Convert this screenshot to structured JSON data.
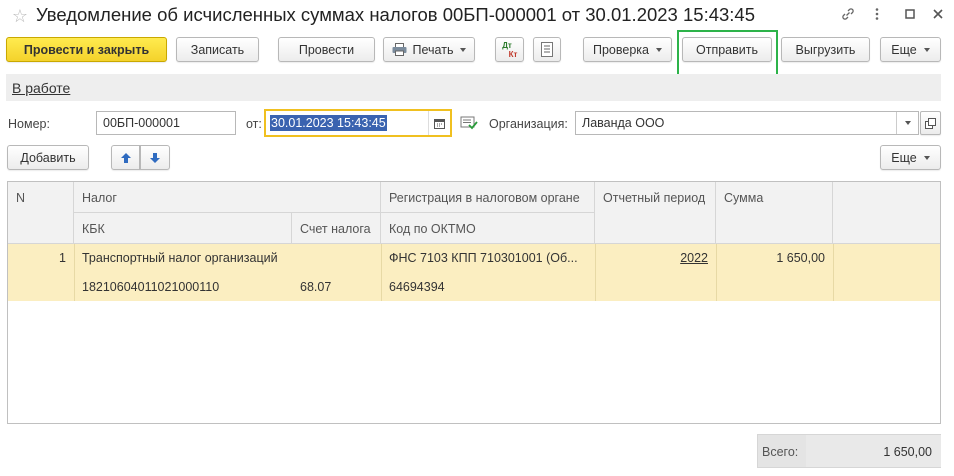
{
  "window": {
    "title": "Уведомление об исчисленных суммах налогов 00БП-000001 от 30.01.2023 15:43:45",
    "icons": [
      "star-icon",
      "link-icon",
      "more-icon",
      "maximize-icon",
      "close-icon"
    ]
  },
  "toolbar": {
    "post_close": "Провести и закрыть",
    "save": "Записать",
    "post": "Провести",
    "print": "Печать",
    "dt_kt_top": "Дт",
    "dt_kt_bottom": "Кт",
    "check": "Проверка",
    "send": "Отправить",
    "export": "Выгрузить",
    "more": "Еще"
  },
  "status": {
    "label": "В работе"
  },
  "form": {
    "number_label": "Номер:",
    "number_value": "00БП-000001",
    "date_label": "от:",
    "date_value": "30.01.2023 15:43:45",
    "org_label": "Организация:",
    "org_value": "Лаванда ООО"
  },
  "table_toolbar": {
    "add": "Добавить",
    "more": "Еще"
  },
  "table": {
    "headers": {
      "n": "N",
      "tax": "Налог",
      "kbk": "КБК",
      "account": "Счет налога",
      "registration": "Регистрация в налоговом органе",
      "oktmo": "Код по ОКТМО",
      "period": "Отчетный период",
      "amount": "Сумма"
    },
    "rows": [
      {
        "n": "1",
        "tax": "Транспортный налог организаций",
        "kbk": "18210604011021000110",
        "account": "68.07",
        "registration": "ФНС 7103 КПП 710301001 (Об...",
        "oktmo": "64694394",
        "period": "2022",
        "amount": "1 650,00"
      }
    ]
  },
  "total": {
    "label": "Всего:",
    "value": "1 650,00"
  },
  "colors": {
    "accent_yellow": "#f4d22b",
    "selection_row": "#fbeec1",
    "send_highlight": "#2db34a",
    "date_selection": "#3a63b0"
  }
}
